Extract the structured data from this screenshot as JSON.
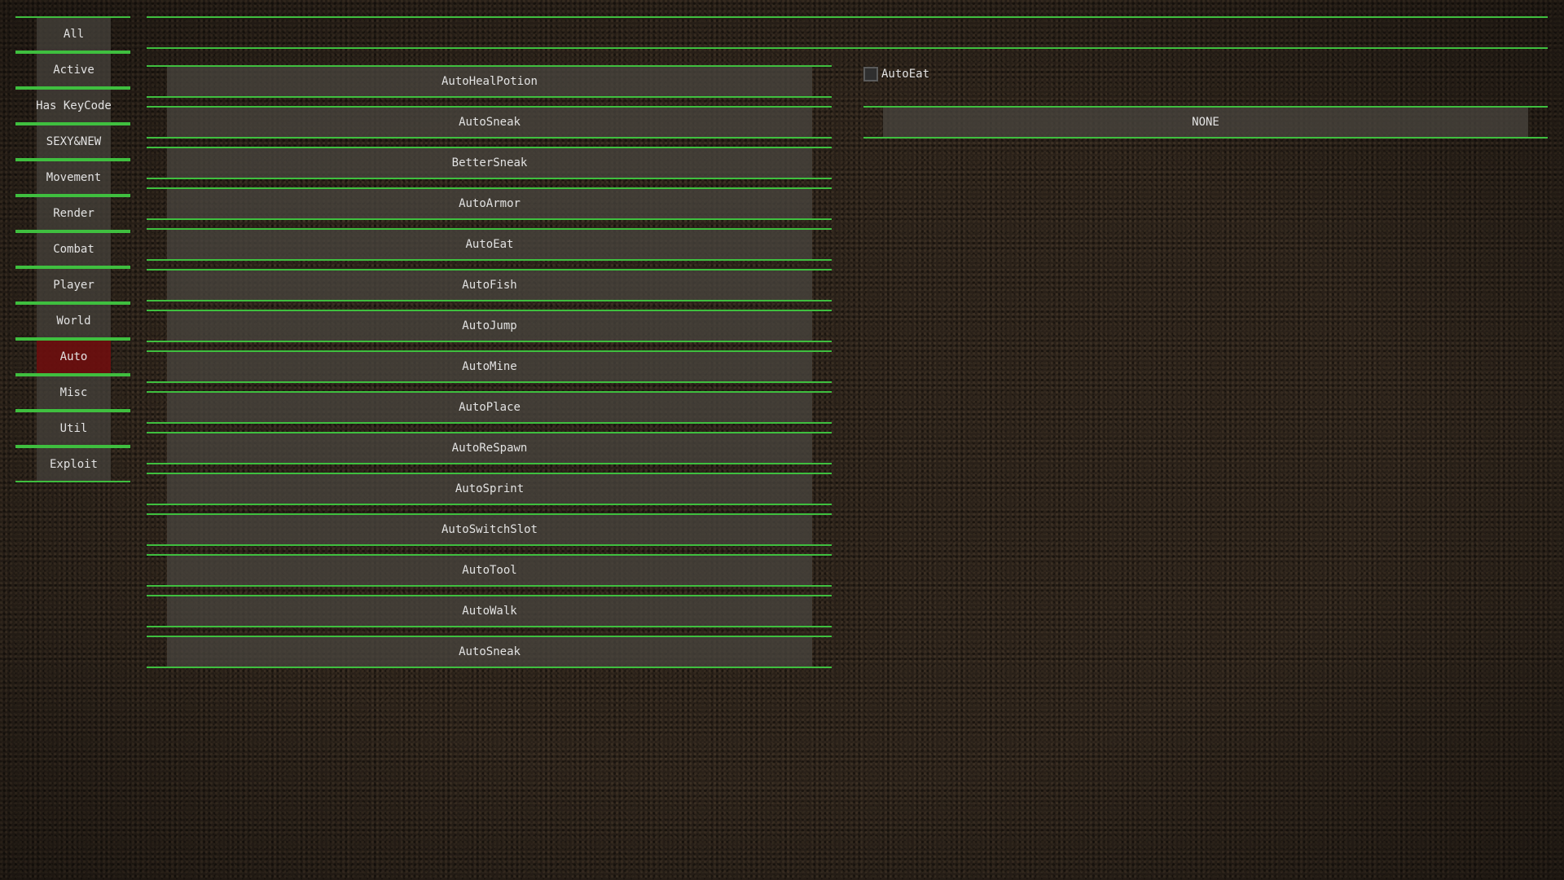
{
  "categories": {
    "selected": "Auto",
    "items": [
      {
        "label": "All"
      },
      {
        "label": "Active"
      },
      {
        "label": "Has KeyCode"
      },
      {
        "label": "SEXY&NEW"
      },
      {
        "label": "Movement"
      },
      {
        "label": "Render"
      },
      {
        "label": "Combat"
      },
      {
        "label": "Player"
      },
      {
        "label": "World"
      },
      {
        "label": "Auto"
      },
      {
        "label": "Misc"
      },
      {
        "label": "Util"
      },
      {
        "label": "Exploit"
      }
    ]
  },
  "modules": {
    "items": [
      {
        "label": "AutoHealPotion"
      },
      {
        "label": "AutoSneak"
      },
      {
        "label": "BetterSneak"
      },
      {
        "label": "AutoArmor"
      },
      {
        "label": "AutoEat"
      },
      {
        "label": "AutoFish"
      },
      {
        "label": "AutoJump"
      },
      {
        "label": "AutoMine"
      },
      {
        "label": "AutoPlace"
      },
      {
        "label": "AutoReSpawn"
      },
      {
        "label": "AutoSprint"
      },
      {
        "label": "AutoSwitchSlot"
      },
      {
        "label": "AutoTool"
      },
      {
        "label": "AutoWalk"
      },
      {
        "label": "AutoSneak"
      }
    ]
  },
  "settings": {
    "toggle": {
      "label": "AutoEat",
      "checked": false
    },
    "keybind": {
      "value": "NONE"
    }
  },
  "colors": {
    "accent_line": "#3fbf3f",
    "selected_category": "#6e0e0e",
    "button_bg": "#48443e",
    "text": "#e2e2e2"
  }
}
